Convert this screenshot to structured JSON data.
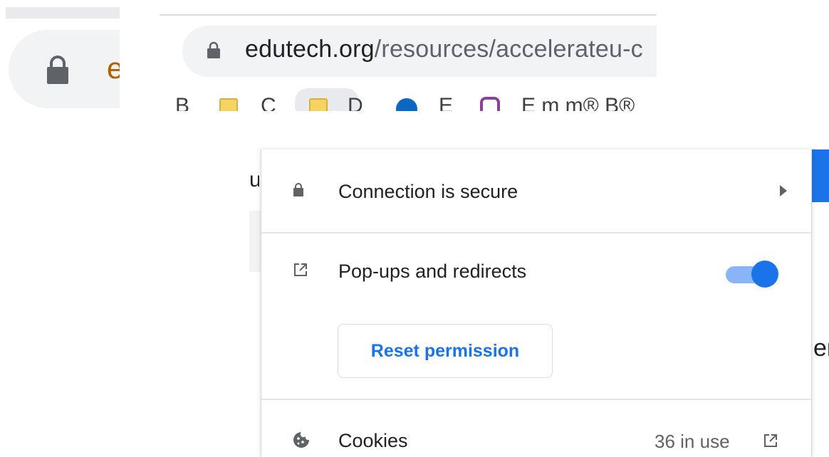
{
  "omnibox": {
    "host": "edutech.org",
    "path": "/resources/accelerateu-c",
    "left_fragment_text": "e"
  },
  "bookmarks": [
    {
      "label": "B",
      "icon": "folder-icon"
    },
    {
      "label": "C",
      "icon": "folder-icon"
    },
    {
      "label": "D",
      "icon": "folder-icon"
    },
    {
      "label": "E",
      "icon": "blue-site-icon"
    },
    {
      "label": "E m m® B®",
      "icon": "purple-site-icon"
    }
  ],
  "background": {
    "left_fragment": "u",
    "right_fragment": "er"
  },
  "popup": {
    "connection_label": "Connection is secure",
    "popups_label": "Pop-ups and redirects",
    "popups_enabled": true,
    "reset_button_label": "Reset permission",
    "cookies_label": "Cookies",
    "cookies_count": "36 in use"
  },
  "colors": {
    "accent": "#1a73e8",
    "toggle_track": "#8ab4f8",
    "text_primary": "#202124",
    "text_secondary": "#5f6368"
  }
}
